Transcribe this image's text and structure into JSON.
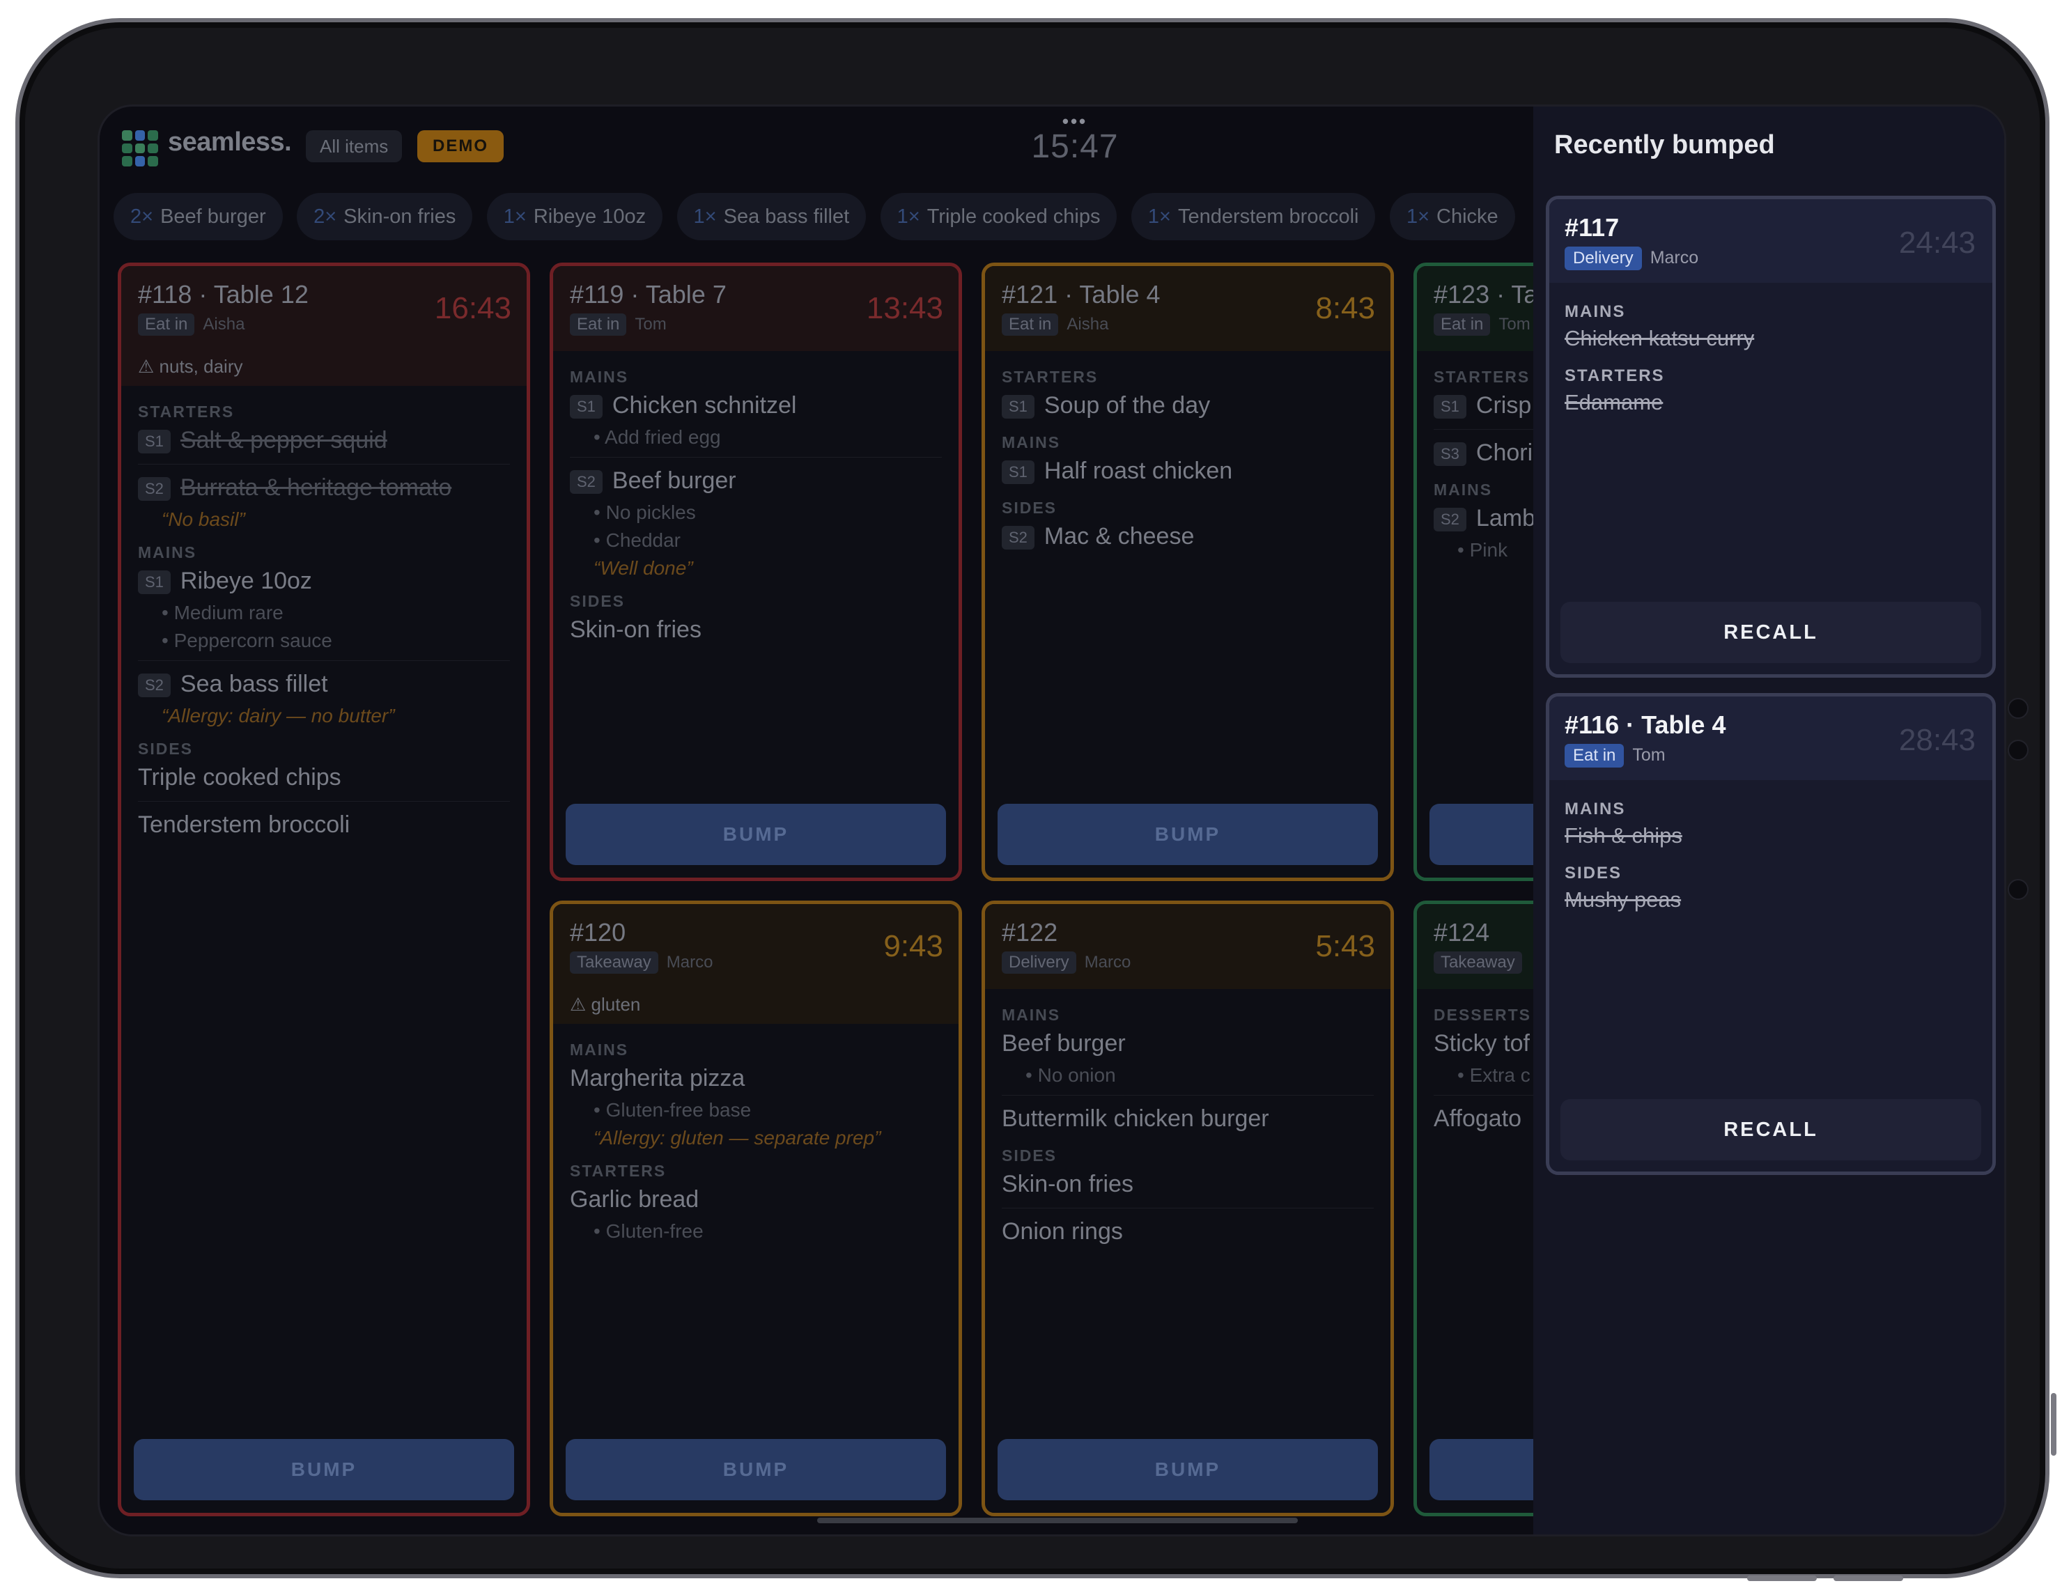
{
  "header": {
    "brand": "seamless.",
    "filter_label": "All items",
    "demo_label": "DEMO",
    "clock": "15:47",
    "more_label": "•••"
  },
  "summary_chips": [
    {
      "qty": "2×",
      "name": "Beef burger"
    },
    {
      "qty": "2×",
      "name": "Skin-on fries"
    },
    {
      "qty": "1×",
      "name": "Ribeye 10oz"
    },
    {
      "qty": "1×",
      "name": "Sea bass fillet"
    },
    {
      "qty": "1×",
      "name": "Triple cooked chips"
    },
    {
      "qty": "1×",
      "name": "Tenderstem broccoli"
    },
    {
      "qty": "1×",
      "name": "Chicke"
    }
  ],
  "bump_label": "BUMP",
  "tickets": {
    "t118": {
      "title": "#118 · Table 12",
      "type": "Eat in",
      "server": "Aisha",
      "timer": "16:43",
      "allergy": "⚠ nuts, dairy",
      "starters": "STARTERS",
      "mains": "MAINS",
      "sides": "SIDES",
      "s1": "S1",
      "s2": "S2",
      "i1": "Salt & pepper squid",
      "i2": "Burrata & heritage tomato",
      "i2_note": "“No basil”",
      "i3": "Ribeye 10oz",
      "i3_mod1": "Medium rare",
      "i3_mod2": "Peppercorn sauce",
      "i4": "Sea bass fillet",
      "i4_note": "“Allergy: dairy — no butter”",
      "i5": "Triple cooked chips",
      "i6": "Tenderstem broccoli"
    },
    "t119": {
      "title": "#119 · Table 7",
      "type": "Eat in",
      "server": "Tom",
      "timer": "13:43",
      "mains": "MAINS",
      "sides": "SIDES",
      "s1": "S1",
      "s2": "S2",
      "i1": "Chicken schnitzel",
      "i1_mod1": "Add fried egg",
      "i2": "Beef burger",
      "i2_mod1": "No pickles",
      "i2_mod2": "Cheddar",
      "i2_note": "“Well done”",
      "i3": "Skin-on fries"
    },
    "t121": {
      "title": "#121 · Table 4",
      "type": "Eat in",
      "server": "Aisha",
      "timer": "8:43",
      "starters": "STARTERS",
      "mains": "MAINS",
      "sides": "SIDES",
      "s1": "S1",
      "s2": "S2",
      "i1": "Soup of the day",
      "i2": "Half roast chicken",
      "i3": "Mac & cheese"
    },
    "t123": {
      "title": "#123 · Ta",
      "type": "Eat in",
      "server": "Tom",
      "starters": "STARTERS",
      "mains": "MAINS",
      "s1": "S1",
      "s2": "S2",
      "s3": "S3",
      "i1": "Crisp",
      "i2": "Chori",
      "i3": "Lamb",
      "i3_mod1": "Pink"
    },
    "t120": {
      "title": "#120",
      "type": "Takeaway",
      "server": "Marco",
      "timer": "9:43",
      "allergy": "⚠ gluten",
      "mains": "MAINS",
      "starters": "STARTERS",
      "i1": "Margherita pizza",
      "i1_mod1": "Gluten-free base",
      "i1_note": "“Allergy: gluten — separate prep”",
      "i2": "Garlic bread",
      "i2_mod1": "Gluten-free"
    },
    "t122": {
      "title": "#122",
      "type": "Delivery",
      "server": "Marco",
      "timer": "5:43",
      "mains": "MAINS",
      "sides": "SIDES",
      "i1": "Beef burger",
      "i1_mod1": "No onion",
      "i2": "Buttermilk chicken burger",
      "i3": "Skin-on fries",
      "i4": "Onion rings"
    },
    "t124": {
      "title": "#124",
      "type": "Takeaway",
      "desserts": "DESSERTS",
      "i1": "Sticky tof",
      "i1_mod1": "Extra c",
      "i2": "Affogato"
    }
  },
  "recent": {
    "title": "Recently bumped",
    "recall_label": "RECALL",
    "r117": {
      "title": "#117",
      "type": "Delivery",
      "server": "Marco",
      "timer": "24:43",
      "mains": "MAINS",
      "i1": "Chicken katsu curry",
      "starters": "STARTERS",
      "i2": "Edamame"
    },
    "r116": {
      "title": "#116 · Table 4",
      "type": "Eat in",
      "server": "Tom",
      "timer": "28:43",
      "mains": "MAINS",
      "i1": "Fish & chips",
      "sides": "SIDES",
      "i2": "Mushy peas"
    }
  }
}
